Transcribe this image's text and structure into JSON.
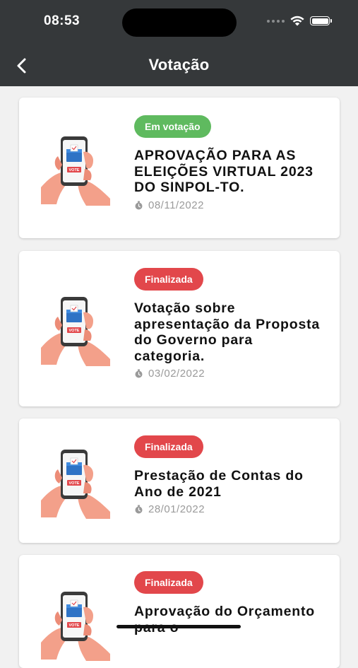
{
  "status_bar": {
    "time": "08:53"
  },
  "header": {
    "title": "Votação",
    "back_icon": "chevron-left-icon"
  },
  "colors": {
    "header_bg": "#35383a",
    "badge_active": "#5fba5f",
    "badge_finished": "#e2474b",
    "page_bg": "#f1f1f1"
  },
  "votes": [
    {
      "status": "Em votação",
      "status_type": "active",
      "title": "APROVAÇÃO PARA AS ELEIÇÕES VIRTUAL 2023 DO SINPOL-TO.",
      "date": "08/11/2022"
    },
    {
      "status": "Finalizada",
      "status_type": "finished",
      "title": "Votação sobre apresentação da Proposta do Governo para categoria.",
      "date": "03/02/2022"
    },
    {
      "status": "Finalizada",
      "status_type": "finished",
      "title": "Prestação de Contas do Ano de 2021",
      "date": "28/01/2022"
    },
    {
      "status": "Finalizada",
      "status_type": "finished",
      "title": "Aprovação do Orçamento para o",
      "date": ""
    }
  ],
  "thumbnail": {
    "icon": "vote-phone-illustration",
    "label": "VOTE"
  }
}
